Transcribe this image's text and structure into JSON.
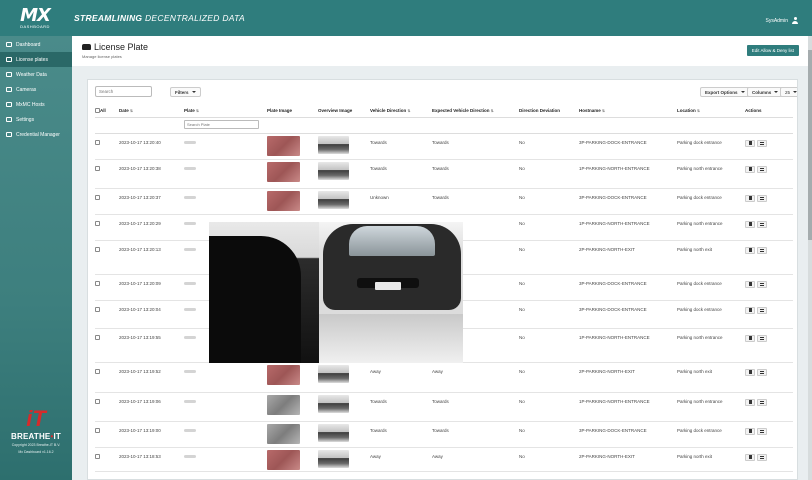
{
  "header": {
    "logo_main": "MX",
    "logo_sub": "DASHBOARD",
    "tagline_bold": "STREAMLINING",
    "tagline_light": "DECENTRALIZED DATA",
    "user": "SysAdmin"
  },
  "sidebar": {
    "items": [
      {
        "label": "Dashboard",
        "icon": "dashboard-icon"
      },
      {
        "label": "License plates",
        "icon": "car-icon"
      },
      {
        "label": "Weather Data",
        "icon": "weather-icon"
      },
      {
        "label": "Cameras",
        "icon": "camera-icon"
      },
      {
        "label": "MxMC Hosts",
        "icon": "host-icon"
      },
      {
        "label": "Settings",
        "icon": "gear-icon"
      },
      {
        "label": "Credential Manager",
        "icon": "key-icon"
      }
    ],
    "brand_name_a": "BREATHE",
    "brand_name_dot": "•",
    "brand_name_b": "IT",
    "copyright": "Copyright 2023 Breathe-IT B.V.",
    "version": "Mx Dashboard v1.16.2"
  },
  "page": {
    "title": "License Plate",
    "subtitle": "Manage license plates",
    "edit_button": "Edit Allow & Deny list"
  },
  "toolbar": {
    "search_placeholder": "Search",
    "filters": "Filters",
    "export": "Export Options",
    "columns": "Columns",
    "page_size": "25"
  },
  "table": {
    "headers": {
      "all": "All",
      "date": "Date",
      "plate": "Plate",
      "plate_image": "Plate Image",
      "overview_image": "Overview Image",
      "vehicle_direction": "Vehicle Direction",
      "expected_direction": "Expected Vehicle Direction",
      "deviation": "Direction Deviation",
      "hostname": "Hostname",
      "location": "Location",
      "actions": "Actions"
    },
    "plate_filter_placeholder": "Search Plate",
    "rows": [
      {
        "date": "2023-10-17 13:20:40",
        "dir": "Towards",
        "exp": "Towards",
        "dev": "No",
        "host": "3P-PARKING-DOCK-ENTRANCE",
        "loc": "Parking dock entrance"
      },
      {
        "date": "2023-10-17 13:20:38",
        "dir": "Towards",
        "exp": "Towards",
        "dev": "No",
        "host": "1P-PARKING-NORTH-ENTRANCE",
        "loc": "Parking north entrance"
      },
      {
        "date": "2023-10-17 13:20:37",
        "dir": "Unknown",
        "exp": "Towards",
        "dev": "No",
        "host": "3P-PARKING-DOCK-ENTRANCE",
        "loc": "Parking dock entrance"
      },
      {
        "date": "2023-10-17 13:20:29",
        "dir": "",
        "exp": "",
        "dev": "No",
        "host": "1P-PARKING-NORTH-ENTRANCE",
        "loc": "Parking north entrance"
      },
      {
        "date": "2023-10-17 13:20:13",
        "dir": "",
        "exp": "",
        "dev": "No",
        "host": "2P-PARKING-NORTH-EXIT",
        "loc": "Parking north exit"
      },
      {
        "date": "2023-10-17 13:20:09",
        "dir": "",
        "exp": "",
        "dev": "No",
        "host": "3P-PARKING-DOCK-ENTRANCE",
        "loc": "Parking dock entrance"
      },
      {
        "date": "2023-10-17 13:20:04",
        "dir": "",
        "exp": "",
        "dev": "No",
        "host": "3P-PARKING-DOCK-ENTRANCE",
        "loc": "Parking dock entrance"
      },
      {
        "date": "2023-10-17 13:19:55",
        "dir": "",
        "exp": "",
        "dev": "No",
        "host": "1P-PARKING-NORTH-ENTRANCE",
        "loc": "Parking north entrance"
      },
      {
        "date": "2023-10-17 13:19:52",
        "dir": "Away",
        "exp": "Away",
        "dev": "No",
        "host": "2P-PARKING-NORTH-EXIT",
        "loc": "Parking north exit"
      },
      {
        "date": "2023-10-17 13:19:06",
        "dir": "Towards",
        "exp": "Towards",
        "dev": "No",
        "host": "1P-PARKING-NORTH-ENTRANCE",
        "loc": "Parking north entrance"
      },
      {
        "date": "2023-10-17 13:19:00",
        "dir": "Towards",
        "exp": "Towards",
        "dev": "No",
        "host": "3P-PARKING-DOCK-ENTRANCE",
        "loc": "Parking dock entrance"
      },
      {
        "date": "2023-10-17 13:18:53",
        "dir": "Away",
        "exp": "Away",
        "dev": "No",
        "host": "2P-PARKING-NORTH-EXIT",
        "loc": "Parking north exit"
      }
    ]
  },
  "colors": {
    "primary": "#2f7d7d",
    "sidebar": "#3d7f7e",
    "brand_red": "#d62b2b"
  }
}
